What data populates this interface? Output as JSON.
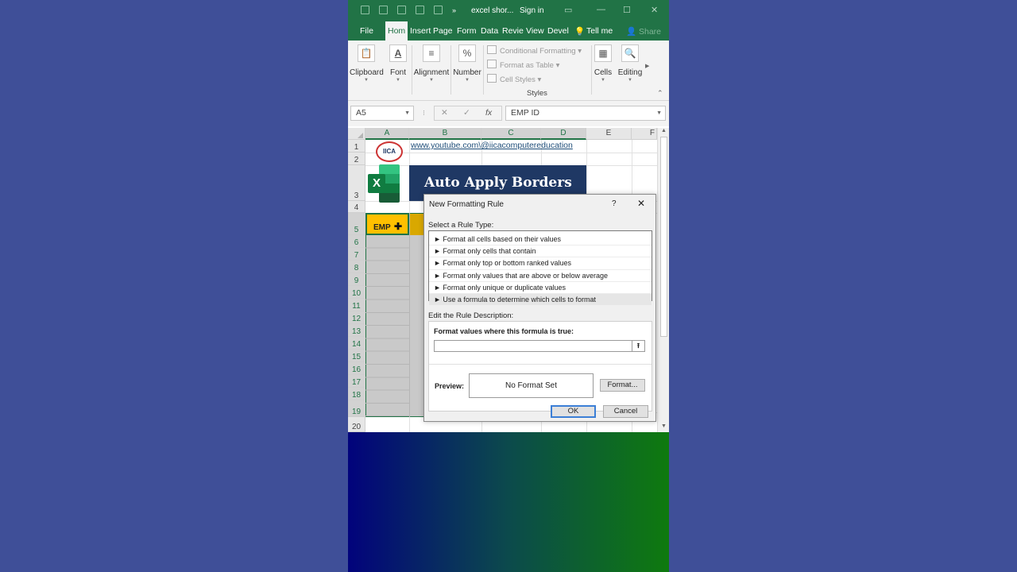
{
  "titlebar": {
    "file_name": "excel shor...",
    "sign_in": "Sign in"
  },
  "tabs": [
    {
      "label": "File",
      "active": false
    },
    {
      "label": "Hom",
      "active": true
    },
    {
      "label": "Insert",
      "active": false
    },
    {
      "label": "Page",
      "active": false
    },
    {
      "label": "Form",
      "active": false
    },
    {
      "label": "Data",
      "active": false
    },
    {
      "label": "Revie",
      "active": false
    },
    {
      "label": "View",
      "active": false
    },
    {
      "label": "Devel",
      "active": false
    }
  ],
  "tell_me": "Tell me",
  "share": "Share",
  "ribbon": {
    "clipboard": "Clipboard",
    "font": "Font",
    "alignment": "Alignment",
    "number": "Number",
    "conditional_formatting": "Conditional Formatting",
    "format_as_table": "Format as Table",
    "cell_styles": "Cell Styles",
    "styles_group": "Styles",
    "cells": "Cells",
    "editing": "Editing"
  },
  "formula_bar": {
    "name_box": "A5",
    "content": "EMP ID"
  },
  "columns": [
    "A",
    "B",
    "C",
    "D",
    "E",
    "F"
  ],
  "rows": [
    "1",
    "2",
    "3",
    "4",
    "5",
    "6",
    "7",
    "8",
    "9",
    "10",
    "11",
    "12",
    "13",
    "14",
    "15",
    "16",
    "17",
    "18",
    "19",
    "20"
  ],
  "sheet": {
    "link": "www.youtube.com\\@iicacomputereducation",
    "logo_text": "IICA",
    "excel_logo_letter": "X",
    "banner": "Auto Apply Borders",
    "a5_value": "EMP"
  },
  "dialog": {
    "title": "New Formatting Rule",
    "help": "?",
    "select_label": "Select a Rule Type:",
    "rule_types": [
      "► Format all cells based on their values",
      "► Format only cells that contain",
      "► Format only top or bottom ranked values",
      "► Format only values that are above or below average",
      "► Format only unique or duplicate values",
      "► Use a formula to determine which cells to format"
    ],
    "selected_index": 5,
    "edit_label": "Edit the Rule Description:",
    "formula_label": "Format values where this formula is true:",
    "formula_value": "",
    "preview_label": "Preview:",
    "preview_text": "No Format Set",
    "format_button": "Format...",
    "ok": "OK",
    "cancel": "Cancel"
  },
  "colors": {
    "excel_green": "#217346",
    "banner_bg": "#1f3864",
    "header_yellow": "#ffc000"
  }
}
